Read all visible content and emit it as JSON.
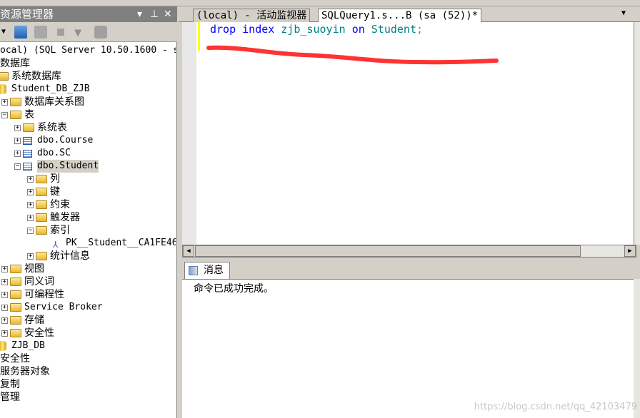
{
  "explorer": {
    "title": "资源管理器",
    "pin_icon": "pin-icon",
    "close_icon": "close-icon"
  },
  "tree": [
    {
      "label": "ocal) (SQL Server 10.50.1600 - s",
      "level": 0,
      "icon": "server",
      "exp": ""
    },
    {
      "label": "数据库",
      "level": 0,
      "icon": "",
      "exp": ""
    },
    {
      "label": "系统数据库",
      "level": 1,
      "icon": "folder",
      "exp": ""
    },
    {
      "label": "Student_DB_ZJB",
      "level": 1,
      "icon": "database",
      "exp": ""
    },
    {
      "label": "数据库关系图",
      "level": 2,
      "icon": "folder",
      "exp": "+"
    },
    {
      "label": "表",
      "level": 2,
      "icon": "folder",
      "exp": "-"
    },
    {
      "label": "系统表",
      "level": 3,
      "icon": "folder",
      "exp": "+"
    },
    {
      "label": "dbo.Course",
      "level": 3,
      "icon": "table",
      "exp": "+"
    },
    {
      "label": "dbo.SC",
      "level": 3,
      "icon": "table",
      "exp": "+"
    },
    {
      "label": "dbo.Student",
      "level": 3,
      "icon": "table",
      "exp": "-",
      "selected": true
    },
    {
      "label": "列",
      "level": 4,
      "icon": "folder",
      "exp": "+"
    },
    {
      "label": "键",
      "level": 4,
      "icon": "folder",
      "exp": "+"
    },
    {
      "label": "约束",
      "level": 4,
      "icon": "folder",
      "exp": "+"
    },
    {
      "label": "触发器",
      "level": 4,
      "icon": "folder",
      "exp": "+"
    },
    {
      "label": "索引",
      "level": 4,
      "icon": "folder",
      "exp": "-"
    },
    {
      "label": "PK__Student__CA1FE46",
      "level": 5,
      "icon": "index",
      "exp": ""
    },
    {
      "label": "统计信息",
      "level": 4,
      "icon": "folder",
      "exp": "+"
    },
    {
      "label": "视图",
      "level": 2,
      "icon": "folder",
      "exp": "+"
    },
    {
      "label": "同义词",
      "level": 2,
      "icon": "folder",
      "exp": "+"
    },
    {
      "label": "可编程性",
      "level": 2,
      "icon": "folder",
      "exp": "+"
    },
    {
      "label": "Service Broker",
      "level": 2,
      "icon": "folder",
      "exp": "+"
    },
    {
      "label": "存储",
      "level": 2,
      "icon": "folder",
      "exp": "+"
    },
    {
      "label": "安全性",
      "level": 2,
      "icon": "folder",
      "exp": "+"
    },
    {
      "label": "ZJB_DB",
      "level": 1,
      "icon": "database",
      "exp": ""
    },
    {
      "label": "安全性",
      "level": 0,
      "icon": "",
      "exp": ""
    },
    {
      "label": "服务器对象",
      "level": 0,
      "icon": "",
      "exp": ""
    },
    {
      "label": "复制",
      "level": 0,
      "icon": "",
      "exp": ""
    },
    {
      "label": "管理",
      "level": 0,
      "icon": "",
      "exp": ""
    }
  ],
  "tabs": [
    {
      "label": "(local) - 活动监视器",
      "active": false
    },
    {
      "label": "SQLQuery1.s...B (sa (52))*",
      "active": true
    }
  ],
  "code": {
    "kw1": "drop",
    "kw2": "index",
    "name": "zjb_suoyin",
    "kw3": "on",
    "table": "Student",
    "semi": ";"
  },
  "annotation_color": "#ff3333",
  "messages": {
    "tab": "消息",
    "text": "命令已成功完成。"
  },
  "watermark": "https://blog.csdn.net/qq_42103479"
}
